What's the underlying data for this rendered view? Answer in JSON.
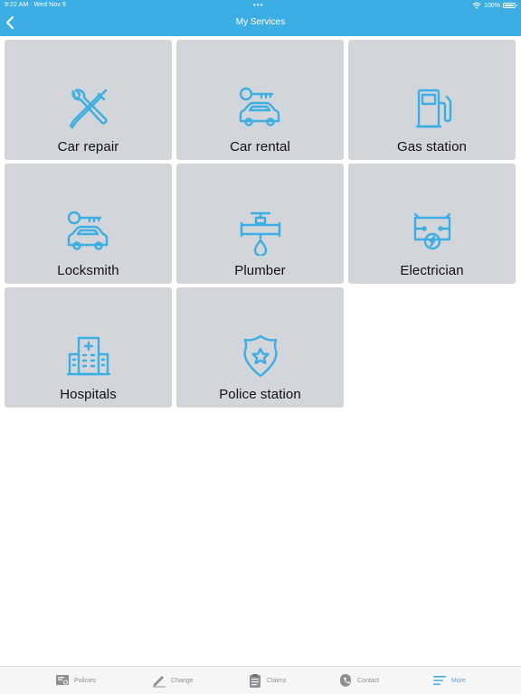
{
  "status_bar": {
    "time": "9:22 AM",
    "date": "Wed Nov 9",
    "battery": "100%"
  },
  "nav": {
    "title": "My Services"
  },
  "services": [
    {
      "label": "Car repair",
      "icon": "wrench-screwdriver-icon"
    },
    {
      "label": "Car rental",
      "icon": "car-key-icon"
    },
    {
      "label": "Gas station",
      "icon": "fuel-pump-icon"
    },
    {
      "label": "Locksmith",
      "icon": "car-key-icon"
    },
    {
      "label": "Plumber",
      "icon": "pipe-faucet-icon"
    },
    {
      "label": "Electrician",
      "icon": "electric-circuit-icon"
    },
    {
      "label": "Hospitals",
      "icon": "hospital-icon"
    },
    {
      "label": "Police station",
      "icon": "police-badge-icon"
    }
  ],
  "tabbar": {
    "items": [
      {
        "label": "Policies",
        "icon": "policy-certificate-icon"
      },
      {
        "label": "Change",
        "icon": "pencil-icon"
      },
      {
        "label": "Claims",
        "icon": "clipboard-icon"
      },
      {
        "label": "Contact",
        "icon": "contact-icon"
      },
      {
        "label": "More",
        "icon": "menu-lines-icon"
      }
    ],
    "active": "More"
  },
  "colors": {
    "accent": "#3daee3",
    "tile_bg": "#d2d5d9",
    "inactive_tab": "#8e8e93"
  }
}
